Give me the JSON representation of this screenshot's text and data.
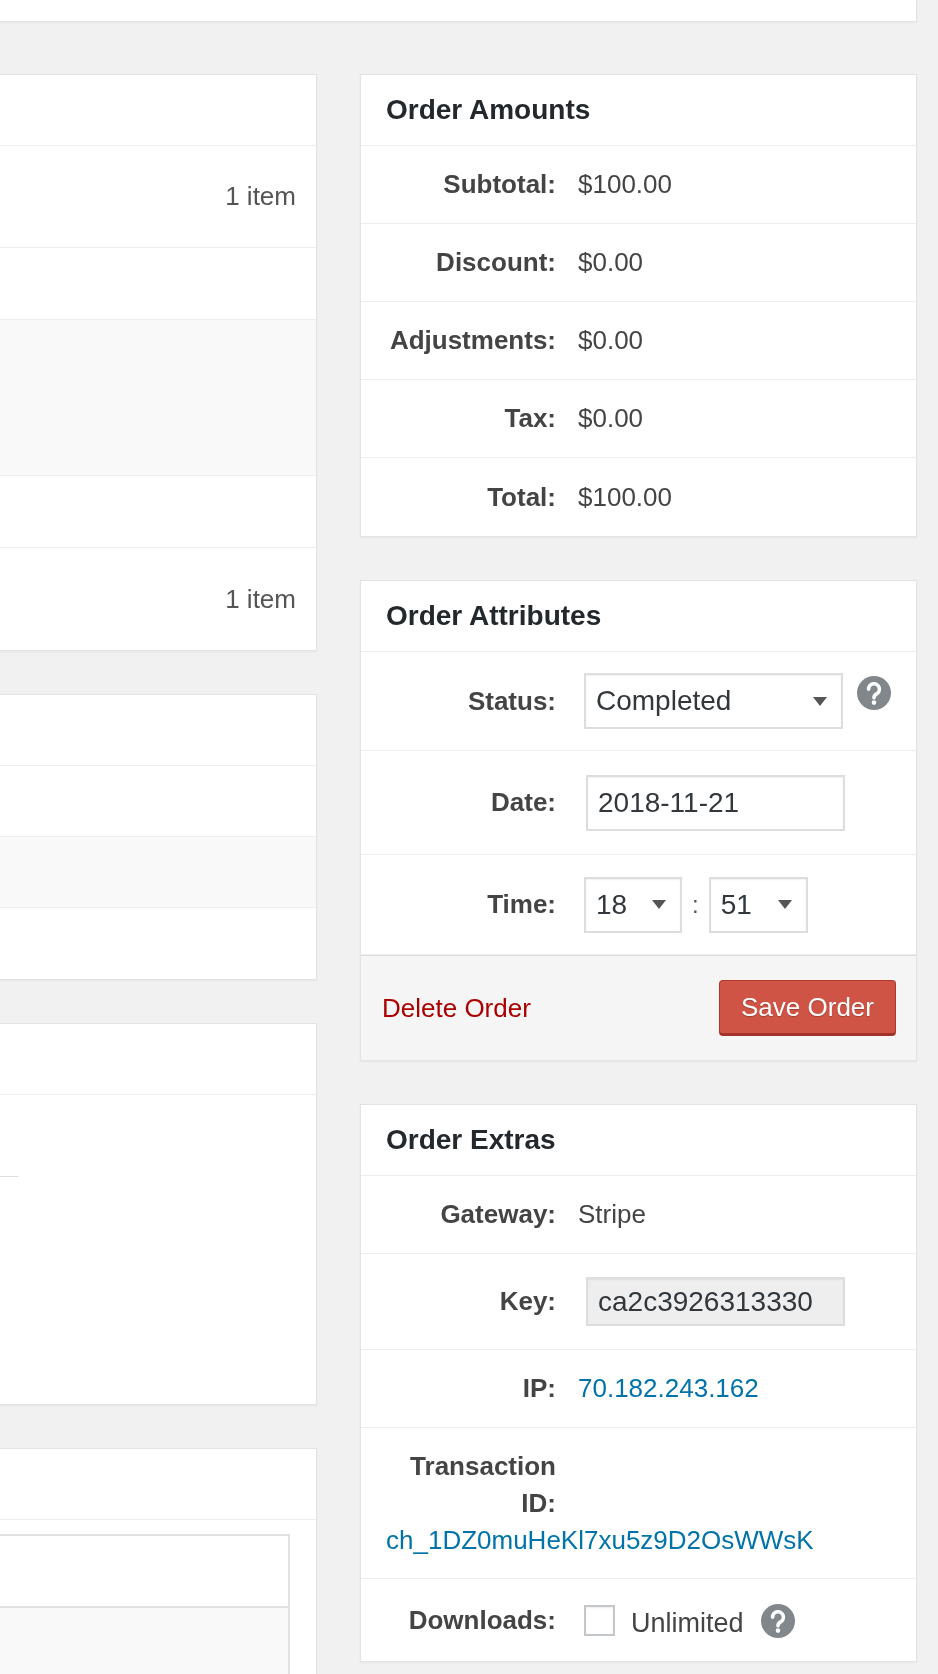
{
  "items_panel": {
    "item_counts": [
      "1 item",
      "1 item"
    ]
  },
  "order_amounts": {
    "title": "Order Amounts",
    "rows": [
      {
        "label": "Subtotal:",
        "value": "$100.00"
      },
      {
        "label": "Discount:",
        "value": "$0.00"
      },
      {
        "label": "Adjustments:",
        "value": "$0.00"
      },
      {
        "label": "Tax:",
        "value": "$0.00"
      },
      {
        "label": "Total:",
        "value": "$100.00"
      }
    ]
  },
  "order_attributes": {
    "title": "Order Attributes",
    "rows": [
      {
        "kind": "select",
        "label": "Status:",
        "value": "Completed",
        "help": true
      },
      {
        "kind": "input",
        "label": "Date:",
        "value": "2018-11-21"
      },
      {
        "kind": "time",
        "label": "Time:",
        "hour": "18",
        "separator": ":",
        "minute": "51"
      }
    ],
    "delete_link": "Delete Order",
    "save_button": "Save Order"
  },
  "order_extras": {
    "title": "Order Extras",
    "rows": [
      {
        "kind": "text",
        "label": "Gateway:",
        "value": "Stripe"
      },
      {
        "kind": "input",
        "label": "Key:",
        "value": "ca2c3926313330",
        "readonly": true
      },
      {
        "kind": "link",
        "label": "IP:",
        "value": "70.182.243.162"
      },
      {
        "kind": "stacked_link",
        "label": "Transaction ID:",
        "value": "ch_1DZ0muHeKl7xu5z9D2OsWWsK"
      },
      {
        "kind": "checkbox",
        "label": "Downloads:",
        "checked": false,
        "option": "Unlimited",
        "help": true
      }
    ]
  }
}
